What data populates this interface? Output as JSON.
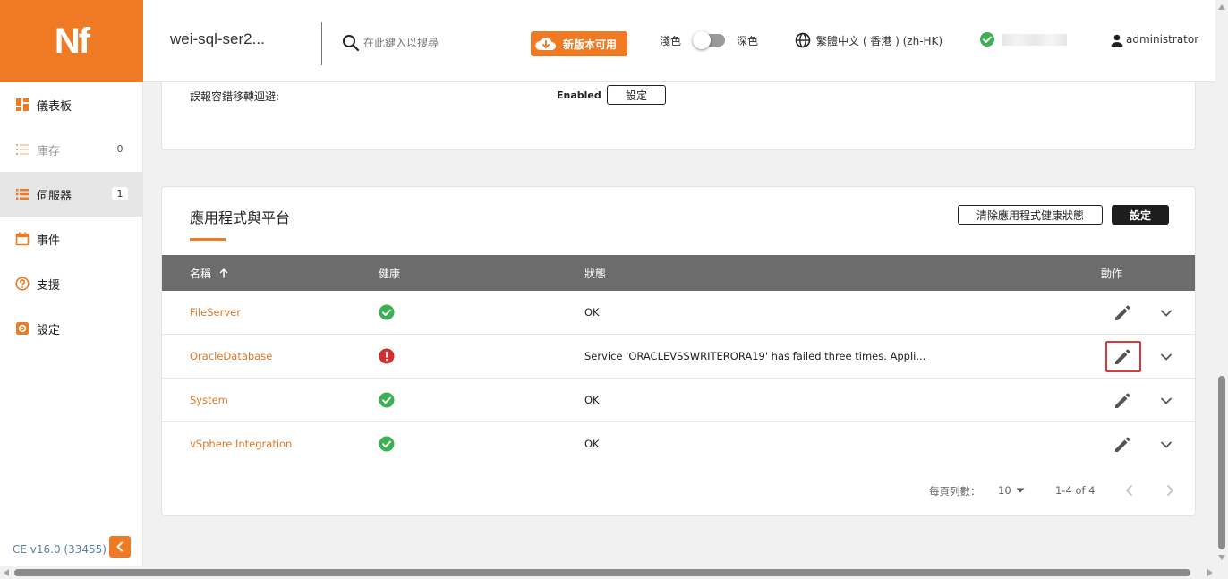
{
  "header": {
    "logo_text": "Nf",
    "host": "wei-sql-ser2...",
    "search_placeholder": "在此鍵入以搜尋",
    "update_label": "新版本可用",
    "theme_light": "淺色",
    "theme_dark": "深色",
    "language": "繁體中文 ( 香港 ) (zh-HK)",
    "user": "administrator"
  },
  "sidebar": {
    "items": [
      {
        "label": "儀表板",
        "icon": "dashboard-icon"
      },
      {
        "label": "庫存",
        "icon": "list-icon",
        "count": "0"
      },
      {
        "label": "伺服器",
        "icon": "server-icon",
        "count": "1"
      },
      {
        "label": "事件",
        "icon": "calendar-icon"
      },
      {
        "label": "支援",
        "icon": "help-icon"
      },
      {
        "label": "設定",
        "icon": "settings-icon"
      }
    ],
    "version": "CE v16.0 (33455)"
  },
  "top_card": {
    "label": "誤報容錯移轉迴避:",
    "value": "Enabled",
    "button": "設定"
  },
  "apps_card": {
    "title": "應用程式與平台",
    "clear_button": "清除應用程式健康狀態",
    "settings_button": "設定",
    "columns": {
      "name": "名稱",
      "health": "健康",
      "state": "狀態",
      "actions": "動作"
    },
    "rows": [
      {
        "name": "FileServer",
        "health": "ok",
        "state": "OK"
      },
      {
        "name": "OracleDatabase",
        "health": "error",
        "state": "Service 'ORACLEVSSWRITERORA19' has failed three times. Appli..."
      },
      {
        "name": "System",
        "health": "ok",
        "state": "OK"
      },
      {
        "name": "vSphere Integration",
        "health": "ok",
        "state": "OK"
      }
    ],
    "pager": {
      "rows_per_page_label": "每頁列數：",
      "rows_per_page": "10",
      "range": "1-4 of 4"
    }
  },
  "colors": {
    "brand": "#ef7a23",
    "ok": "#3cb052",
    "error": "#d32f2f",
    "table_header": "#6c6c6c"
  }
}
